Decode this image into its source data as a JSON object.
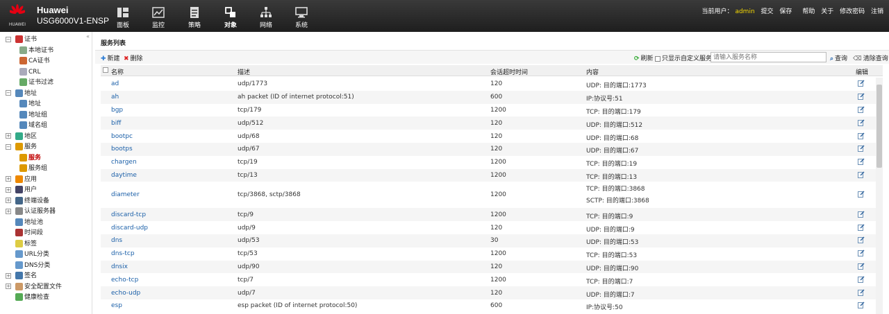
{
  "header": {
    "logo_text": "HUAWEI",
    "brand": "Huawei",
    "model": "USG6000V1-ENSP",
    "nav": [
      {
        "label": "面板",
        "icon": "dashboard-icon"
      },
      {
        "label": "监控",
        "icon": "monitor-icon"
      },
      {
        "label": "策略",
        "icon": "policy-icon"
      },
      {
        "label": "对象",
        "icon": "object-icon"
      },
      {
        "label": "网络",
        "icon": "network-icon"
      },
      {
        "label": "系统",
        "icon": "system-icon"
      }
    ],
    "active_nav": "对象",
    "current_user_label": "当前用户：",
    "current_user": "admin",
    "links": [
      "提交",
      "保存",
      "帮助",
      "关于",
      "修改密码",
      "注销"
    ]
  },
  "sidebar": {
    "collapse_label": "«",
    "items": [
      {
        "label": "证书",
        "level": 0,
        "toggle": "−",
        "icon_color": "#c33"
      },
      {
        "label": "本地证书",
        "level": 1,
        "icon_color": "#8a8"
      },
      {
        "label": "CA证书",
        "level": 1,
        "icon_color": "#c63"
      },
      {
        "label": "CRL",
        "level": 1,
        "icon_color": "#aab"
      },
      {
        "label": "证书过滤",
        "level": 1,
        "icon_color": "#6a6"
      },
      {
        "label": "地址",
        "level": 0,
        "toggle": "−",
        "icon_color": "#58b"
      },
      {
        "label": "地址",
        "level": 1,
        "icon_color": "#58b"
      },
      {
        "label": "地址组",
        "level": 1,
        "icon_color": "#58b"
      },
      {
        "label": "域名组",
        "level": 1,
        "icon_color": "#58b"
      },
      {
        "label": "地区",
        "level": 0,
        "toggle": "+",
        "icon_color": "#3a8"
      },
      {
        "label": "服务",
        "level": 0,
        "toggle": "−",
        "icon_color": "#d90"
      },
      {
        "label": "服务",
        "level": 1,
        "icon_color": "#d90",
        "selected": true
      },
      {
        "label": "服务组",
        "level": 1,
        "icon_color": "#d90"
      },
      {
        "label": "应用",
        "level": 0,
        "toggle": "+",
        "icon_color": "#e80"
      },
      {
        "label": "用户",
        "level": 0,
        "toggle": "+",
        "icon_color": "#446"
      },
      {
        "label": "终端设备",
        "level": 0,
        "toggle": "+",
        "icon_color": "#468"
      },
      {
        "label": "认证服务器",
        "level": 0,
        "toggle": "+",
        "icon_color": "#888"
      },
      {
        "label": "地址池",
        "level": 0,
        "icon_color": "#58b"
      },
      {
        "label": "时间段",
        "level": 0,
        "icon_color": "#a33"
      },
      {
        "label": "标签",
        "level": 0,
        "icon_color": "#dc4"
      },
      {
        "label": "URL分类",
        "level": 0,
        "icon_color": "#69c"
      },
      {
        "label": "DNS分类",
        "level": 0,
        "icon_color": "#69c"
      },
      {
        "label": "签名",
        "level": 0,
        "toggle": "+",
        "icon_color": "#47a"
      },
      {
        "label": "安全配置文件",
        "level": 0,
        "toggle": "+",
        "icon_color": "#c96"
      },
      {
        "label": "健康检查",
        "level": 0,
        "icon_color": "#5a5"
      }
    ]
  },
  "main": {
    "title": "服务列表",
    "toolbar": {
      "new_label": "新建",
      "delete_label": "删除",
      "refresh_label": "刷新",
      "only_custom_label": "只显示自定义服务",
      "search_placeholder": "请输入服务名称",
      "search_label": "查询",
      "clear_label": "清除查询"
    },
    "columns": [
      "名称",
      "描述",
      "会话超时时间",
      "内容",
      "编辑"
    ],
    "rows": [
      {
        "name": "ad",
        "desc": "udp/1773",
        "timeout": "120",
        "content": [
          "UDP: 目的端口:1773"
        ]
      },
      {
        "name": "ah",
        "desc": "ah packet (ID of internet protocol:51)",
        "timeout": "600",
        "content": [
          "IP:协议号:51"
        ]
      },
      {
        "name": "bgp",
        "desc": "tcp/179",
        "timeout": "1200",
        "content": [
          "TCP: 目的端口:179"
        ]
      },
      {
        "name": "biff",
        "desc": "udp/512",
        "timeout": "120",
        "content": [
          "UDP: 目的端口:512"
        ]
      },
      {
        "name": "bootpc",
        "desc": "udp/68",
        "timeout": "120",
        "content": [
          "UDP: 目的端口:68"
        ]
      },
      {
        "name": "bootps",
        "desc": "udp/67",
        "timeout": "120",
        "content": [
          "UDP: 目的端口:67"
        ]
      },
      {
        "name": "chargen",
        "desc": "tcp/19",
        "timeout": "1200",
        "content": [
          "TCP: 目的端口:19"
        ]
      },
      {
        "name": "daytime",
        "desc": "tcp/13",
        "timeout": "1200",
        "content": [
          "TCP: 目的端口:13"
        ]
      },
      {
        "name": "diameter",
        "desc": "tcp/3868, sctp/3868",
        "timeout": "1200",
        "content": [
          "TCP: 目的端口:3868",
          "SCTP: 目的端口:3868"
        ]
      },
      {
        "name": "discard-tcp",
        "desc": "tcp/9",
        "timeout": "1200",
        "content": [
          "TCP: 目的端口:9"
        ]
      },
      {
        "name": "discard-udp",
        "desc": "udp/9",
        "timeout": "120",
        "content": [
          "UDP: 目的端口:9"
        ]
      },
      {
        "name": "dns",
        "desc": "udp/53",
        "timeout": "30",
        "content": [
          "UDP: 目的端口:53"
        ]
      },
      {
        "name": "dns-tcp",
        "desc": "tcp/53",
        "timeout": "1200",
        "content": [
          "TCP: 目的端口:53"
        ]
      },
      {
        "name": "dnsix",
        "desc": "udp/90",
        "timeout": "120",
        "content": [
          "UDP: 目的端口:90"
        ]
      },
      {
        "name": "echo-tcp",
        "desc": "tcp/7",
        "timeout": "1200",
        "content": [
          "TCP: 目的端口:7"
        ]
      },
      {
        "name": "echo-udp",
        "desc": "udp/7",
        "timeout": "120",
        "content": [
          "UDP: 目的端口:7"
        ]
      },
      {
        "name": "esp",
        "desc": "esp packet (ID of internet protocol:50)",
        "timeout": "600",
        "content": [
          "IP:协议号:50"
        ]
      }
    ]
  },
  "colors": {
    "link": "#1a5fa8",
    "selected": "#c00000",
    "user": "#f5d800",
    "huawei_red": "#e60012"
  }
}
